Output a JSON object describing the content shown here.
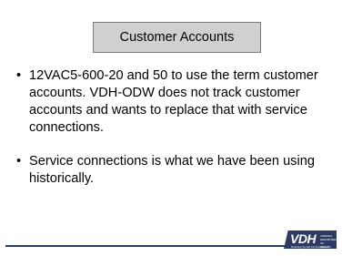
{
  "slide": {
    "title": "Customer Accounts",
    "bullets": [
      "12VAC5-600-20 and 50 to use the term customer accounts.  VDH-ODW does not track customer accounts and wants to replace that with service connections.",
      "Service connections is what we have been using historically."
    ],
    "logo": {
      "mark": "VDH",
      "subtitle": "VIRGINIA DEPARTMENT OF HEALTH",
      "tagline": "Protecting You and Your Environment"
    }
  },
  "colors": {
    "title_fill": "#d0d0d0",
    "brand": "#2d3a63"
  }
}
